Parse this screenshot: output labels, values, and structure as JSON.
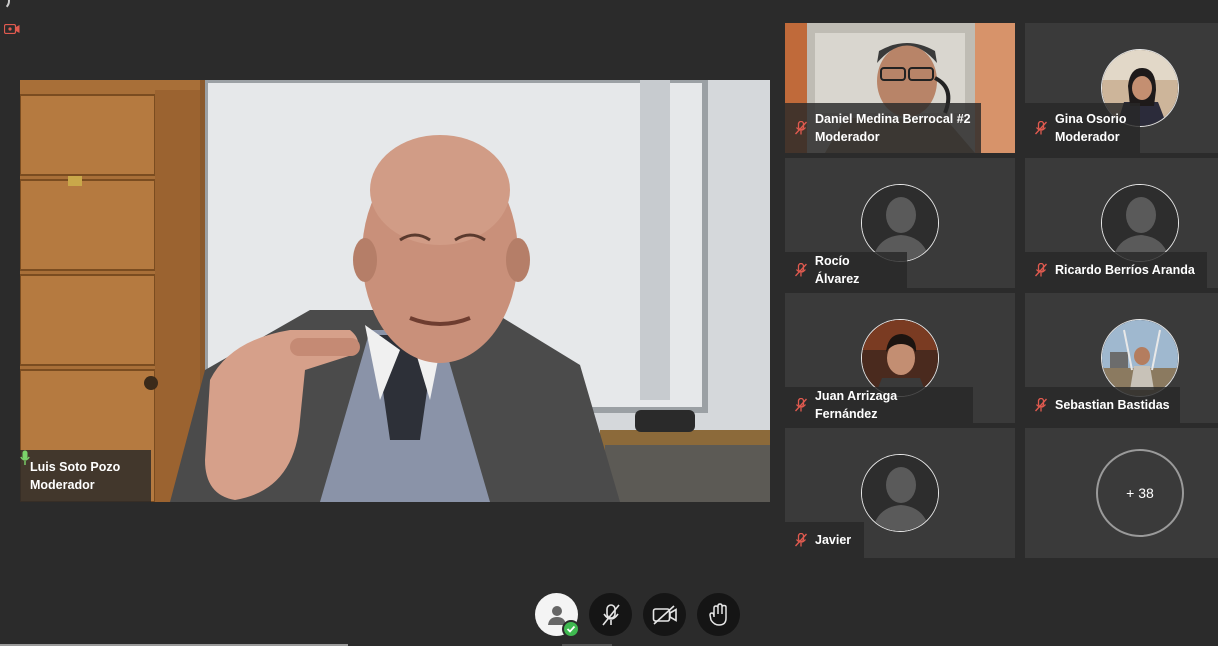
{
  "main": {
    "speaker_name": "Luis Soto Pozo",
    "speaker_role": "Moderador"
  },
  "participants": [
    {
      "name": "Daniel Medina Berrocal #2",
      "role": "Moderador"
    },
    {
      "name": "Gina Osorio",
      "role": "Moderador"
    },
    {
      "name": "Rocío Álvarez",
      "role": ""
    },
    {
      "name": "Ricardo Berríos Aranda",
      "role": ""
    },
    {
      "name": "Juan Arrizaga Fernández",
      "role": ""
    },
    {
      "name": "Sebastian Bastidas",
      "role": ""
    },
    {
      "name": "Javier",
      "role": ""
    }
  ],
  "overflow_count": "+ 38",
  "toolbar": {
    "icons": [
      "user-status-icon",
      "mic-muted-icon",
      "camera-off-icon",
      "raise-hand-icon"
    ]
  },
  "colors": {
    "muted_mic": "#e05a4f",
    "active_mic": "#7bd36a",
    "status_check": "#3fb950",
    "background": "#2b2b2b",
    "tile": "#3a3a3a"
  }
}
